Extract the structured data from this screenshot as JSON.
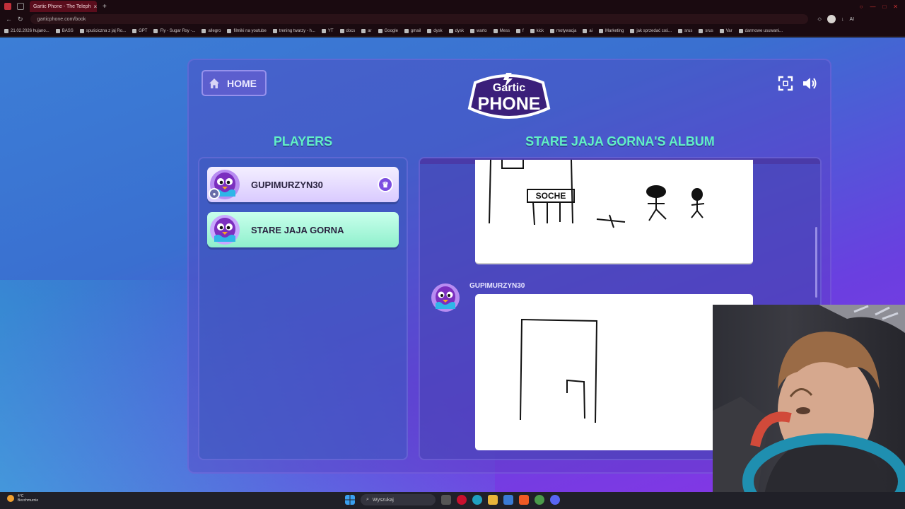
{
  "browser": {
    "tab_title": "Gartic Phone - The Teleph",
    "url": "garticphone.com/book",
    "bookmarks": [
      "21.02.2026 hujano...",
      "BASS",
      "spuściczna z jaj Ro...",
      "GPT",
      "Fly - Sugar Rsy -...",
      "allegro",
      "filmiki na youtube",
      "trening twarzy - h...",
      "YT",
      "docs",
      "ar",
      "Google",
      "gmail",
      "dysk",
      "dysk",
      "warto",
      "Mess",
      "f",
      "kick",
      "motywacja",
      "ai",
      "Marketing",
      "jak sprzedać coś...",
      "srus",
      "srus",
      "Var",
      "darmowe usuwani..."
    ]
  },
  "game": {
    "home_label": "HOME",
    "logo_top": "Gartic",
    "logo_bottom": "PHONE",
    "players_title": "PLAYERS",
    "album_title": "STARE JAJA GORNA'S ALBUM",
    "players": [
      {
        "name": "GUPIMURZYN30",
        "is_host": true
      },
      {
        "name": "STARE JAJA GORNA",
        "is_host": false
      }
    ],
    "entry_author": "GUPIMURZYN30",
    "drawing_text": "SOCHE"
  },
  "taskbar": {
    "temperature": "4°C",
    "weather": "Bezchmurnie",
    "search_placeholder": "Wyszukaj"
  },
  "colors": {
    "accent": "#61f0c6",
    "host_card": "#e6dcff",
    "active_card": "#a9f6d8"
  }
}
